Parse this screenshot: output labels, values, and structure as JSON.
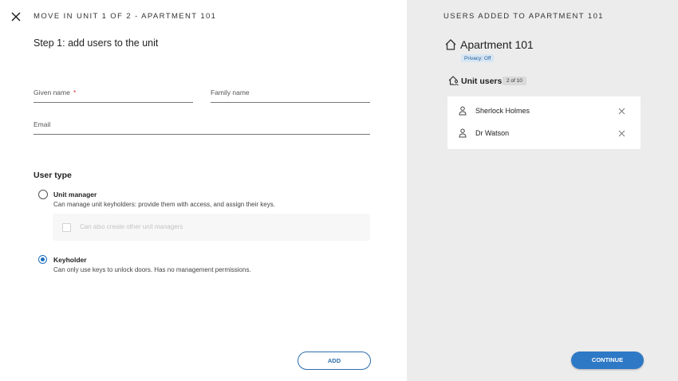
{
  "header": {
    "title": "MOVE IN UNIT 1 OF 2 - APARTMENT 101",
    "close_icon": "close-icon"
  },
  "form": {
    "step_title": "Step 1: add users to the unit",
    "given_name": {
      "label": "Given name",
      "required_marker": "*",
      "value": ""
    },
    "family_name": {
      "label": "Family name",
      "value": ""
    },
    "email": {
      "label": "Email",
      "value": ""
    },
    "user_type": {
      "title": "User type",
      "options": [
        {
          "label": "Unit manager",
          "description": "Can manage unit keyholders: provide them with access, and assign their keys.",
          "selected": false
        },
        {
          "label": "Keyholder",
          "description": "Can only use keys to unlock doors. Has no management permissions.",
          "selected": true
        }
      ],
      "sub_option": {
        "label": "Can also create other unit managers",
        "checked": false,
        "disabled": true
      }
    },
    "add_label": "ADD"
  },
  "sidebar": {
    "header": "USERS ADDED TO APARTMENT 101",
    "apartment_title": "Apartment 101",
    "privacy_badge": "Privacy: Off",
    "unit_users_title": "Unit users",
    "unit_users_count": "2 of 10",
    "users": [
      {
        "name": "Sherlock Holmes"
      },
      {
        "name": "Dr Watson"
      }
    ],
    "continue_label": "CONTINUE"
  },
  "colors": {
    "accent": "#2e79c6",
    "required": "#d32f2f",
    "panel_bg": "#ececec"
  }
}
